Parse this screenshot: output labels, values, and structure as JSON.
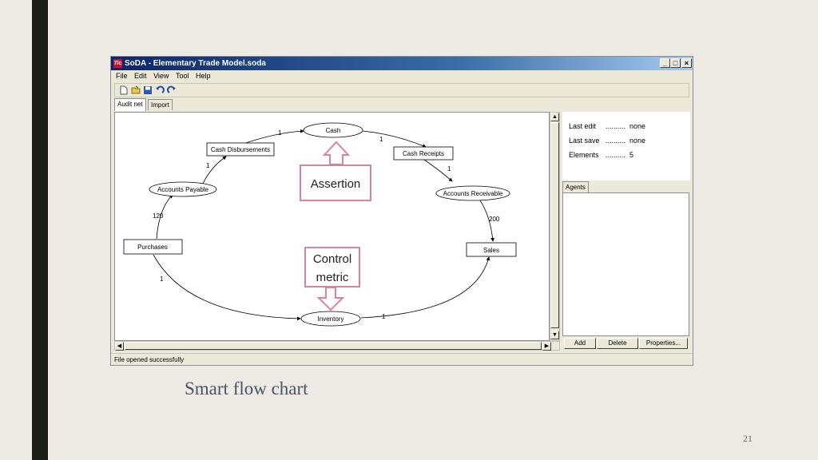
{
  "window": {
    "title": "SoDA - Elementary Trade Model.soda",
    "icon_text": "7/c",
    "controls": {
      "minimize": "_",
      "maximize": "□",
      "close": "×"
    }
  },
  "menu": {
    "file": "File",
    "edit": "Edit",
    "view": "View",
    "tool": "Tool",
    "help": "Help"
  },
  "toolbar_icons": [
    "new-file-icon",
    "open-folder-icon",
    "save-icon",
    "undo-icon",
    "redo-icon"
  ],
  "tabs": {
    "audit_net": "Audit net",
    "import": "Import"
  },
  "diagram": {
    "nodes": {
      "cash": "Cash",
      "cash_disbursements": "Cash Disbursements",
      "cash_receipts": "Cash Receipts",
      "accounts_payable": "Accounts Payable",
      "accounts_receivable": "Accounts Receivable",
      "purchases": "Purchases",
      "sales": "Sales",
      "inventory": "Inventory"
    },
    "edge_labels": {
      "cd_to_cash": "1",
      "cash_to_cr": "1",
      "ap_to_cd": "1",
      "cr_to_ar": "1",
      "purchases_to_ap": "120",
      "ar_to_sales": "200",
      "purchases_to_inventory": "1",
      "inventory_to_sales": "1"
    },
    "callouts": {
      "assertion": "Assertion",
      "control_line1": "Control",
      "control_line2": "metric"
    },
    "callout_color": "#d9849a"
  },
  "info_panel": {
    "last_edit": {
      "label": "Last edit",
      "dots": "..........",
      "value": "none"
    },
    "last_save": {
      "label": "Last save",
      "dots": "..........",
      "value": "none"
    },
    "elements": {
      "label": "Elements",
      "dots": "..........",
      "value": "5"
    }
  },
  "agents_tab": "Agents",
  "buttons": {
    "add": "Add",
    "delete": "Delete",
    "properties": "Properties..."
  },
  "status": "File opened successfully",
  "slide": {
    "caption": "Smart flow chart",
    "page_number": "21"
  }
}
